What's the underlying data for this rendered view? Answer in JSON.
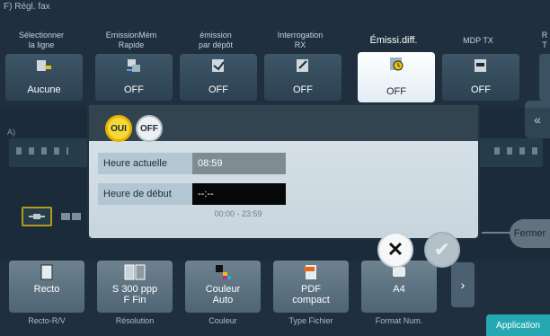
{
  "header": {
    "title": "F)  Régl. fax"
  },
  "tabs": [
    {
      "label": "Sélectionner\nla ligne",
      "value": "Aucune",
      "icon": "line-select-icon"
    },
    {
      "label": "EmissionMém\nRapide",
      "value": "OFF",
      "icon": "quick-memory-tx-icon"
    },
    {
      "label": "émission\npar dépôt",
      "value": "OFF",
      "icon": "bulletin-tx-icon"
    },
    {
      "label": "Interrogation\nRX",
      "value": "OFF",
      "icon": "polling-rx-icon"
    },
    {
      "label": "Émissi.diff.",
      "value": "OFF",
      "icon": "timer-tx-icon",
      "active": true
    },
    {
      "label": "MDP TX",
      "value": "OFF",
      "icon": "password-tx-icon"
    }
  ],
  "corner_tab_label": "R\nT",
  "section_a_label": "A)",
  "back_icon": "double-chevron-left-icon",
  "dialog": {
    "toggle_on": "OUI",
    "toggle_off": "OFF",
    "current_time_label": "Heure actuelle",
    "current_time_value": "08:59",
    "start_time_label": "Heure de début",
    "start_time_value": "--:--",
    "range_hint": "00:00 - 23:59"
  },
  "cancel_icon": "close-x-icon",
  "confirm_icon": "checkmark-icon",
  "close_label": "Fermer",
  "bottom_settings": [
    {
      "value": "Recto",
      "caption": "Recto-R/V",
      "icon": "simplex-icon"
    },
    {
      "value": "S 300 ppp\nF Fin",
      "caption": "Résolution",
      "icon": "resolution-icon"
    },
    {
      "value": "Couleur\nAuto",
      "caption": "Couleur",
      "icon": "color-icon"
    },
    {
      "value": "PDF\ncompact",
      "caption": "Type Fichier",
      "icon": "pdf-file-icon"
    },
    {
      "value": "A4",
      "caption": "Format Num.",
      "icon": "scan-size-icon"
    }
  ],
  "more_icon": "chevron-right-icon",
  "application_label": "Application",
  "colors": {
    "accent_yellow": "#f5d93a",
    "teal": "#26a8b3",
    "bg": "#1f2f3e"
  }
}
